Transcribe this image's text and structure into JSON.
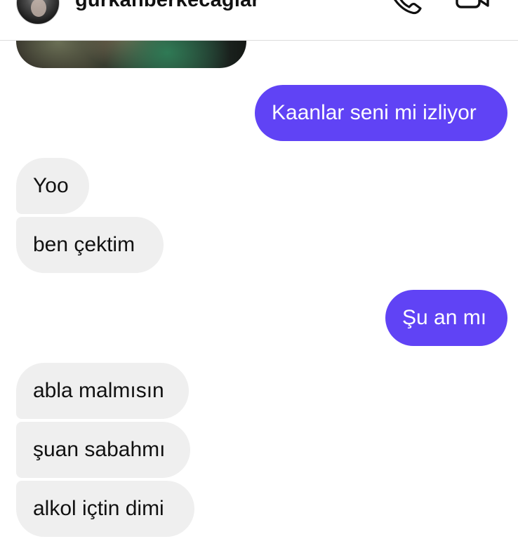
{
  "header": {
    "username": "gurkanberkecaglar",
    "avatar_icon": "profile-photo",
    "call_icon": "phone-icon",
    "video_icon": "video-camera-icon"
  },
  "colors": {
    "outgoing_bubble": "#6043f5",
    "incoming_bubble": "#efefef"
  },
  "messages": [
    {
      "direction": "in",
      "type": "media",
      "text": ""
    },
    {
      "direction": "out",
      "text": "Kaanlar seni mi izliyor"
    },
    {
      "direction": "in",
      "text": "Yoo"
    },
    {
      "direction": "in",
      "text": "ben çektim"
    },
    {
      "direction": "out",
      "text": "Şu an mı"
    },
    {
      "direction": "in",
      "text": "abla malmısın"
    },
    {
      "direction": "in",
      "text": "şuan sabahmı"
    },
    {
      "direction": "in",
      "text": "alkol içtin dimi"
    }
  ]
}
